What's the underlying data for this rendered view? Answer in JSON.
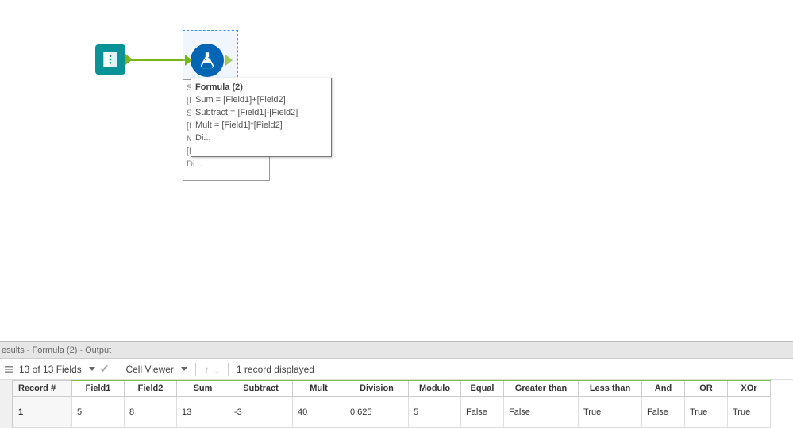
{
  "canvas": {
    "tooltip": {
      "title": "Formula (2)",
      "lines": [
        "Sum = [Field1]+[Field2]",
        "Subtract = [Field1]-[Field2]",
        "Mult = [Field1]*[Field2]",
        "Di..."
      ]
    },
    "config_back_lines": [
      "S",
      "[I",
      "S",
      "[I",
      "M",
      "[Field2]",
      "Di..."
    ]
  },
  "results": {
    "tab_title": "esults - Formula (2) - Output",
    "toolbar": {
      "fields_dropdown": "13 of 13 Fields",
      "cell_viewer": "Cell Viewer",
      "records_text": "1 record displayed"
    },
    "columns": [
      "Record #",
      "Field1",
      "Field2",
      "Sum",
      "Subtract",
      "Mult",
      "Division",
      "Modulo",
      "Equal",
      "Greater than",
      "Less than",
      "And",
      "OR",
      "XOr"
    ],
    "rows": [
      {
        "Record #": "1",
        "Field1": "5",
        "Field2": "8",
        "Sum": "13",
        "Subtract": "-3",
        "Mult": "40",
        "Division": "0.625",
        "Modulo": "5",
        "Equal": "False",
        "Greater than": "False",
        "Less than": "True",
        "And": "False",
        "OR": "True",
        "XOr": "True"
      }
    ]
  }
}
